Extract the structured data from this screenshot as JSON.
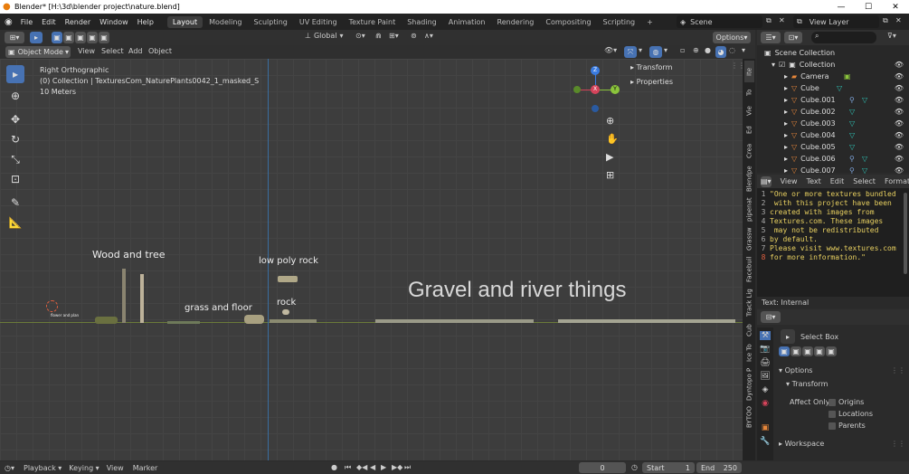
{
  "window": {
    "title": "Blender* [H:\\3d\\blender project\\nature.blend]",
    "min": "—",
    "max": "☐",
    "close": "✕"
  },
  "menu": [
    "File",
    "Edit",
    "Render",
    "Window",
    "Help"
  ],
  "workspace_tabs": [
    "Layout",
    "Modeling",
    "Sculpting",
    "UV Editing",
    "Texture Paint",
    "Shading",
    "Animation",
    "Rendering",
    "Compositing",
    "Scripting"
  ],
  "active_tab": "Layout",
  "scene": {
    "label": "Scene",
    "view_layer": "View Layer"
  },
  "viewport_header": {
    "mode": "Object Mode",
    "items": [
      "View",
      "Select",
      "Add",
      "Object"
    ],
    "orientation": "Global",
    "options": "Options"
  },
  "overlay_info": {
    "view": "Right Orthographic",
    "collection": "(0) Collection | TexturesCom_NaturePlants0042_1_masked_S",
    "scale": "10 Meters"
  },
  "npanel": {
    "transform": "Transform",
    "properties": "Properties",
    "tabs": [
      "Ite",
      "To",
      "Vie",
      "Ed",
      "Crea",
      "Blendpe",
      "pipenat",
      "Grassw",
      "Facebuil",
      "Track Lig",
      "Cub",
      "Ice To",
      "Dyntopo P",
      "BYTOO"
    ]
  },
  "scene_labels": {
    "wood": "Wood and tree",
    "grass": "grass and floor",
    "lowpoly": "low poly rock",
    "rock": "rock",
    "flower": "flower and plan",
    "gravel": "Gravel and river things"
  },
  "outliner": {
    "root": "Scene Collection",
    "collection": "Collection",
    "items": [
      "Camera",
      "Cube",
      "Cube.001",
      "Cube.002",
      "Cube.003",
      "Cube.004",
      "Cube.005",
      "Cube.006",
      "Cube.007"
    ]
  },
  "text_editor": {
    "menu": [
      "View",
      "Text",
      "Edit",
      "Select",
      "Format"
    ],
    "lines": [
      "\"One or more textures bundled",
      " with this project have been",
      "created with images from",
      "Textures.com. These images",
      " may not be redistributed",
      "by default.",
      "Please visit www.textures.com",
      "for more information.\""
    ],
    "footer": "Text: Internal"
  },
  "properties": {
    "tool": "Select Box",
    "options": "Options",
    "transform": "Transform",
    "affect_only": "Affect Only",
    "origins": "Origins",
    "locations": "Locations",
    "parents": "Parents",
    "workspace": "Workspace"
  },
  "timeline": {
    "items": [
      "Playback",
      "Keying",
      "View",
      "Marker"
    ],
    "frame": "0",
    "start_label": "Start",
    "start": "1",
    "end_label": "End",
    "end": "250"
  },
  "colors": {
    "accent": "#4772b3",
    "active_orange": "#e6863a",
    "grass_green": "#6a7a3a",
    "axis_x": "#d4435a",
    "axis_y": "#8bc43c",
    "axis_z": "#3a7be0"
  }
}
